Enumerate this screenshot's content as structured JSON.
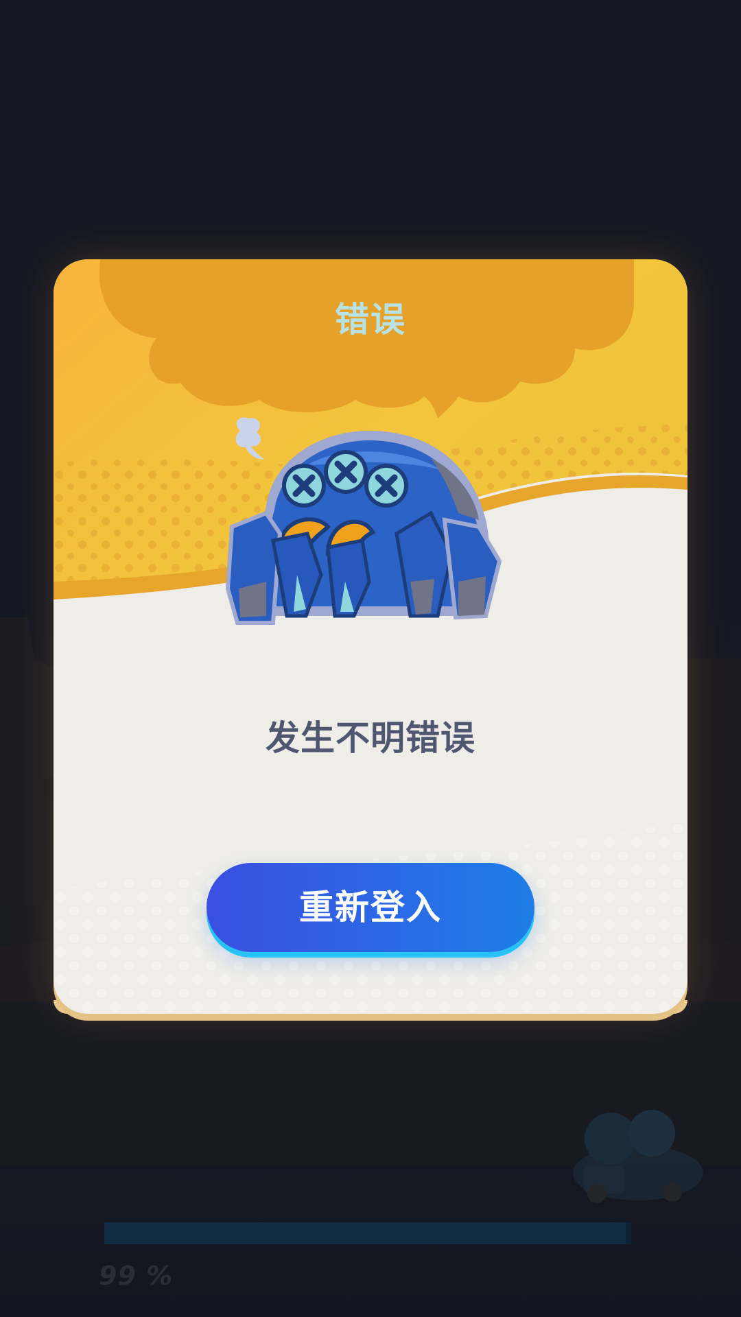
{
  "dialog": {
    "title": "错误",
    "message": "发生不明错误",
    "button_label": "重新登入"
  },
  "loading": {
    "progress_text": "99 %",
    "progress_fraction": 0.99
  },
  "colors": {
    "banner_yellow": "#f2c13a",
    "cloud_orange": "#e59f2a",
    "button_blue": "#2a5fe4",
    "button_rim": "#26c4f4",
    "title_text": "#b8e3e6",
    "message_text": "#4f5670"
  },
  "icons": {
    "mascot": "dazed-blue-spider-robot",
    "smoke": "smoke-puff-icon"
  }
}
